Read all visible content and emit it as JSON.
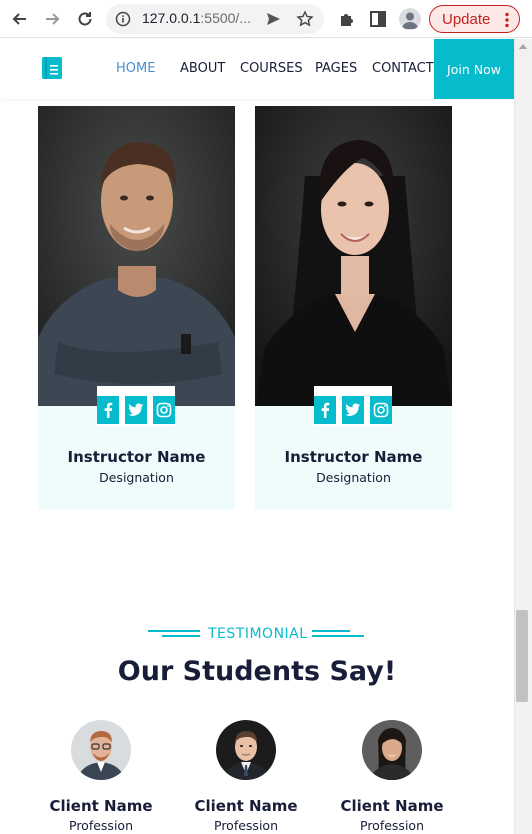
{
  "browser": {
    "url_main": "127.0.0.1",
    "url_rest": ":5500/...",
    "update_label": "Update"
  },
  "header": {
    "menu": [
      "HOME",
      "ABOUT",
      "COURSES",
      "PAGES",
      "CONTACT"
    ],
    "active_item": "HOME",
    "join_label": "Join Now",
    "accent_color": "#06bbcc",
    "dark_color": "#181d38"
  },
  "instructors": [
    {
      "name": "Instructor Name",
      "designation": "Designation",
      "socials": [
        "facebook-icon",
        "twitter-icon",
        "instagram-icon"
      ]
    },
    {
      "name": "Instructor Name",
      "designation": "Designation",
      "socials": [
        "facebook-icon",
        "twitter-icon",
        "instagram-icon"
      ]
    }
  ],
  "testimonial": {
    "tag": "TESTIMONIAL",
    "title": "Our Students Say!",
    "clients": [
      {
        "name": "Client Name",
        "profession": "Profession"
      },
      {
        "name": "Client Name",
        "profession": "Profession"
      },
      {
        "name": "Client Name",
        "profession": "Profession"
      }
    ]
  }
}
